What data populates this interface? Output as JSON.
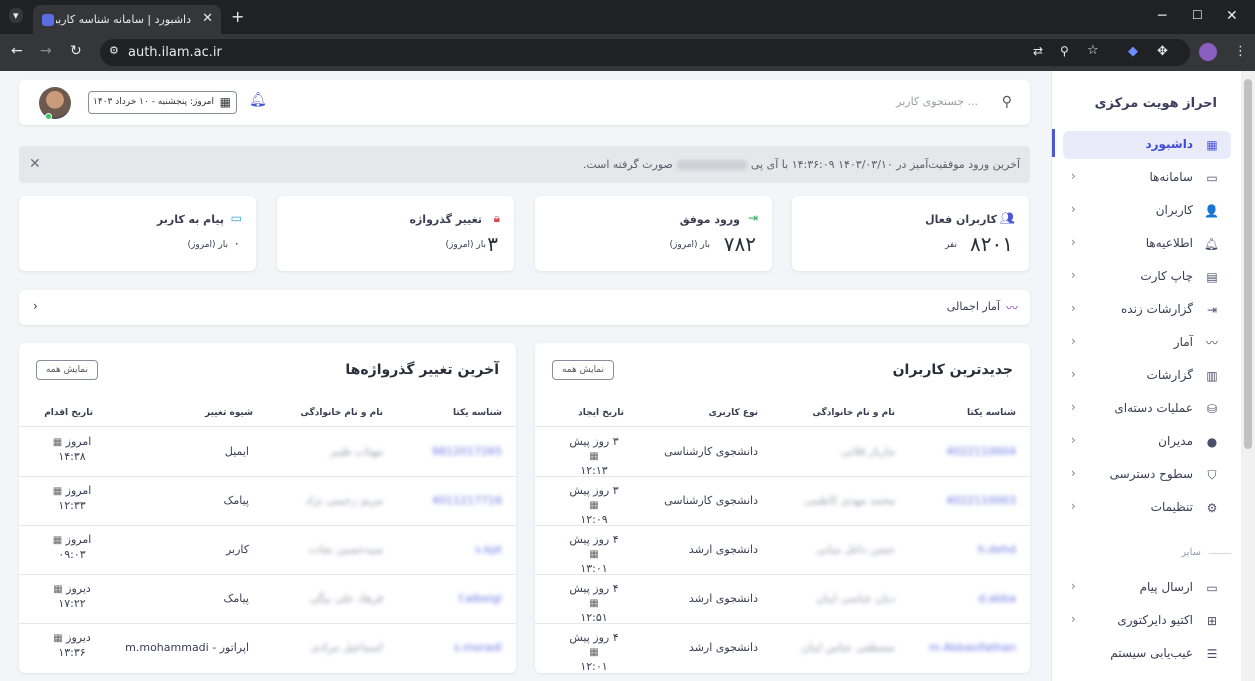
{
  "browser": {
    "tab_title": "داشبورد | سامانه شناسه کاربری یک",
    "url": "auth.ilam.ac.ir"
  },
  "sidebar": {
    "brand": "احراز هویت مرکزی",
    "items": [
      {
        "label": "داشبورد",
        "icon": "dashboard-icon",
        "active": true
      },
      {
        "label": "سامانه‌ها",
        "icon": "window-icon"
      },
      {
        "label": "کاربران",
        "icon": "users-icon"
      },
      {
        "label": "اطلاعیه‌ها",
        "icon": "bell-icon"
      },
      {
        "label": "چاپ کارت",
        "icon": "id-card-icon"
      },
      {
        "label": "گزارشات زنده",
        "icon": "login-icon"
      },
      {
        "label": "آمار",
        "icon": "activity-icon"
      },
      {
        "label": "گزارشات",
        "icon": "report-icon"
      },
      {
        "label": "عملیات دسته‌ای",
        "icon": "database-icon"
      },
      {
        "label": "مدیران",
        "icon": "admin-icon"
      },
      {
        "label": "سطوح دسترسی",
        "icon": "shield-icon"
      },
      {
        "label": "تنظیمات",
        "icon": "gear-icon"
      }
    ],
    "other_section": "سایر",
    "other_items": [
      {
        "label": "ارسال پیام",
        "icon": "message-icon"
      },
      {
        "label": "اکتیو دایرکتوری",
        "icon": "windows-icon"
      },
      {
        "label": "عیب‌یابی سیستم",
        "icon": "server-icon"
      }
    ]
  },
  "topbar": {
    "search_placeholder": "جستجوی کاربر ...",
    "date": "امروز: پنجشنبه - ۱۰ خرداد ۱۴۰۳"
  },
  "alert": {
    "text_before": "آخرین ورود موفقیت‌آمیز در ۱۴۰۳/۰۳/۱۰ ۱۴:۳۶:۰۹ با آی پی",
    "text_after": "صورت گرفته است."
  },
  "stats": [
    {
      "title": "کاربران فعال",
      "value": "۸۲۰۱",
      "unit": "نفر",
      "icon": "users-icon",
      "color": "#4a58d8"
    },
    {
      "title": "ورود موفق",
      "value": "۷۸۲",
      "unit": "بار (امروز)",
      "icon": "login-icon",
      "color": "#2fae5a"
    },
    {
      "title": "تغییر گذرواژه",
      "value": "۳",
      "unit": "بار (امروز)",
      "icon": "lock-icon",
      "color": "#d84a4a"
    },
    {
      "title": "پیام به کاربر",
      "value": "۰",
      "unit": "بار (امروز)",
      "icon": "message-icon",
      "color": "#2fa6c9"
    }
  ],
  "summary": {
    "label": "آمار اجمالی"
  },
  "new_users": {
    "title": "جدیدترین کاربران",
    "show_all": "نمایش همه",
    "headers": [
      "شناسه یکتا",
      "نام و نام خانوادگی",
      "نوع کاربری",
      "تاریخ ایجاد"
    ],
    "rows": [
      {
        "id": "4022110004",
        "name": "مازیار قلاتی",
        "type": "دانشجوی کارشناسی",
        "date": "۳ روز پیش",
        "time": "۱۲:۱۳"
      },
      {
        "id": "4022110003",
        "name": "محمد مهدی کاظمی",
        "type": "دانشجوی کارشناسی",
        "date": "۳ روز پیش",
        "time": "۱۲:۰۹"
      },
      {
        "id": "h.dehd",
        "name": "حسن داغل مبانی",
        "type": "دانشجوی ارشد",
        "date": "۴ روز پیش",
        "time": "۱۳:۰۱"
      },
      {
        "id": "d.abba",
        "name": "دیان عباسی ایبان",
        "type": "دانشجوی ارشد",
        "date": "۴ روز پیش",
        "time": "۱۲:۵۱"
      },
      {
        "id": "m.Abbasifathan",
        "name": "مصطفی عباس ایبان",
        "type": "دانشجوی ارشد",
        "date": "۴ روز پیش",
        "time": "۱۲:۰۱"
      }
    ]
  },
  "password_changes": {
    "title": "آخرین تغییر گذرواژه‌ها",
    "show_all": "نمایش همه",
    "headers": [
      "شناسه یکتا",
      "نام و نام خانوادگی",
      "شیوه تغییر",
      "تاریخ اقدام"
    ],
    "rows": [
      {
        "id": "9812017265",
        "name": "مهتاب طیبر",
        "method": "ایمیل",
        "date": "امروز",
        "time": "۱۴:۳۸"
      },
      {
        "id": "4011217716",
        "name": "مریم رحیمی نژاد",
        "method": "پیامک",
        "date": "امروز",
        "time": "۱۲:۳۳"
      },
      {
        "id": "s.kpt",
        "name": "سیدحسین نجات",
        "method": "کاربر",
        "date": "امروز",
        "time": "۰۹:۰۳"
      },
      {
        "id": "f.albeigi",
        "name": "فرهاد علی بیگی",
        "method": "پیامک",
        "date": "دیروز",
        "time": "۱۷:۲۲"
      },
      {
        "id": "s.moradi",
        "name": "اسماعیل مرادی",
        "method": "اپراتور - m.mohammadi",
        "date": "دیروز",
        "time": "۱۳:۳۶"
      }
    ]
  }
}
